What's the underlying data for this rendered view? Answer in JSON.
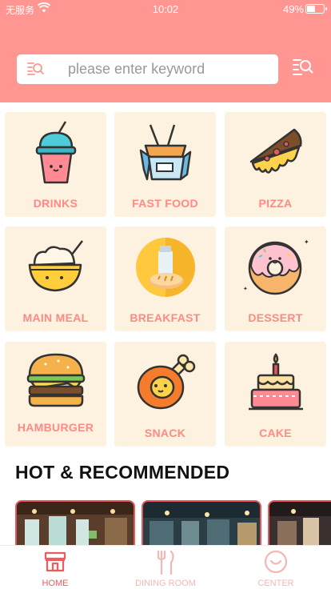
{
  "status_bar": {
    "carrier": "无服务",
    "time": "10:02",
    "battery": "49%"
  },
  "search": {
    "placeholder": "please enter keyword",
    "value": ""
  },
  "categories": [
    {
      "label": "DRINKS",
      "icon": "drink-icon"
    },
    {
      "label": "FAST FOOD",
      "icon": "noodle-box-icon"
    },
    {
      "label": "PIZZA",
      "icon": "pizza-icon"
    },
    {
      "label": "MAIN MEAL",
      "icon": "bowl-icon"
    },
    {
      "label": "BREAKFAST",
      "icon": "bread-milk-icon"
    },
    {
      "label": "DESSERT",
      "icon": "donut-icon"
    },
    {
      "label": "HAMBURGER",
      "icon": "hamburger-icon"
    },
    {
      "label": "SNACK",
      "icon": "drumstick-icon"
    },
    {
      "label": "CAKE",
      "icon": "cake-icon"
    }
  ],
  "section": {
    "title": "HOT & RECOMMENDED"
  },
  "tabbar": {
    "items": [
      {
        "label": "HOME",
        "icon": "store-icon",
        "active": true
      },
      {
        "label": "DINING ROOM",
        "icon": "fork-knife-icon",
        "active": false
      },
      {
        "label": "CENTER",
        "icon": "smile-face-icon",
        "active": false
      }
    ]
  },
  "colors": {
    "header": "#ff9691",
    "tile_bg": "#fdf1df",
    "label": "#ff8a85",
    "accent": "#ef5a5c"
  }
}
